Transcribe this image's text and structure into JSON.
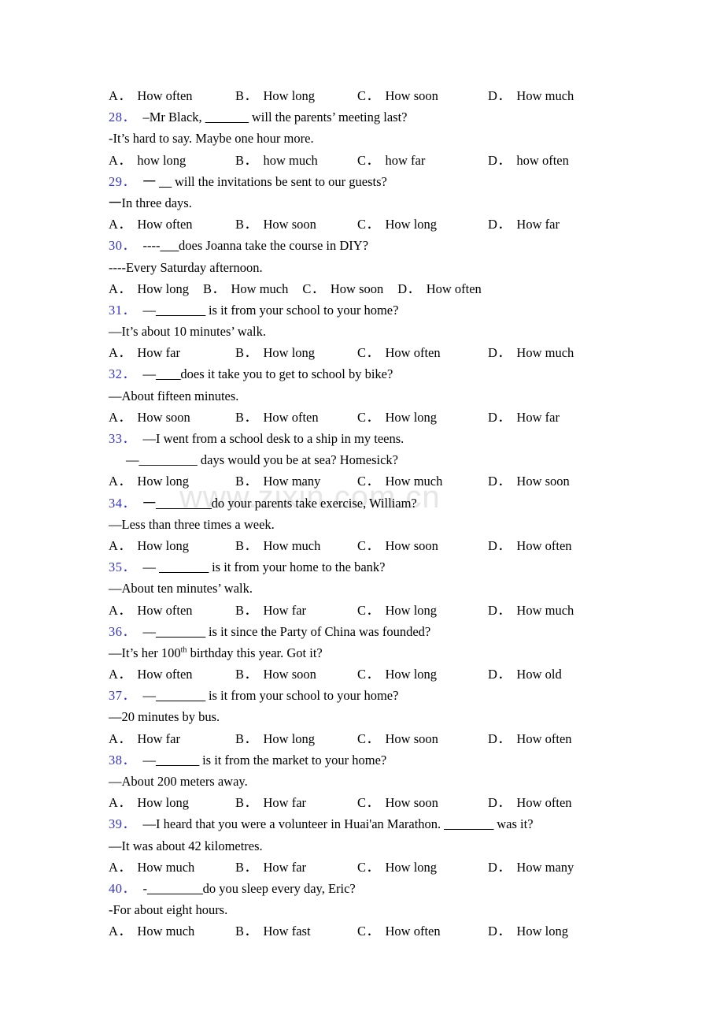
{
  "document": {
    "watermark": "www.zixin.com.cn",
    "accent_color": "#3333cc",
    "text_color": "#000000",
    "background_color": "#ffffff"
  },
  "blocks": [
    {
      "type": "options",
      "layout": "spread",
      "options": [
        {
          "letter": "A．",
          "text": "How often"
        },
        {
          "letter": "B．",
          "text": "How long"
        },
        {
          "letter": "C．",
          "text": "How soon"
        },
        {
          "letter": "D．",
          "text": "How much"
        }
      ]
    },
    {
      "type": "question",
      "number": "28．",
      "stem_before": "–Mr Black, ",
      "blank": "_______",
      "stem_after": " will the parents’ meeting last?",
      "reply": "-It’s hard to say. Maybe one hour more.",
      "layout": "spread",
      "options": [
        {
          "letter": "A．",
          "text": "how long"
        },
        {
          "letter": "B．",
          "text": "how much"
        },
        {
          "letter": "C．",
          "text": "how far"
        },
        {
          "letter": "D．",
          "text": "how often"
        }
      ]
    },
    {
      "type": "question",
      "number": "29．",
      "stem_before": "一 ",
      "blank": "__",
      "stem_after": " will the invitations be sent to our guests?",
      "reply": "一In three days.",
      "layout": "spread",
      "options": [
        {
          "letter": "A．",
          "text": "How often"
        },
        {
          "letter": "B．",
          "text": "How soon"
        },
        {
          "letter": "C．",
          "text": "How long"
        },
        {
          "letter": "D．",
          "text": "How far"
        }
      ]
    },
    {
      "type": "question",
      "number": "30．",
      "stem_before": "----",
      "blank": "___",
      "stem_after": "does Joanna take the course in DIY?",
      "reply": "----Every Saturday afternoon.",
      "layout": "compact",
      "options": [
        {
          "letter": "A．",
          "text": "How long"
        },
        {
          "letter": "B．",
          "text": "How much"
        },
        {
          "letter": "C．",
          "text": "How soon"
        },
        {
          "letter": "D．",
          "text": "How often"
        }
      ]
    },
    {
      "type": "question",
      "number": "31．",
      "stem_before": "—",
      "blank": "________",
      "stem_after": " is it from your school to your home?",
      "reply": "—It’s about 10 minutes’ walk.",
      "layout": "spread",
      "options": [
        {
          "letter": "A．",
          "text": "How far"
        },
        {
          "letter": "B．",
          "text": "How long"
        },
        {
          "letter": "C．",
          "text": "How often"
        },
        {
          "letter": "D．",
          "text": "How much"
        }
      ]
    },
    {
      "type": "question",
      "number": "32．",
      "stem_before": "—",
      "blank": "____",
      "stem_after": "does it take you to get to school by bike?",
      "reply": "—About fifteen minutes.",
      "layout": "spread",
      "options": [
        {
          "letter": "A．",
          "text": "How soon"
        },
        {
          "letter": "B．",
          "text": "How often"
        },
        {
          "letter": "C．",
          "text": "How long"
        },
        {
          "letter": "D．",
          "text": "How far"
        }
      ]
    },
    {
      "type": "question",
      "number": "33．",
      "stem_before": "—I went from a school desk to a ship in my teens.",
      "blank": "",
      "stem_after": "",
      "reply_indented": "—_________ days would you be at sea? Homesick?",
      "layout": "spread",
      "options": [
        {
          "letter": "A．",
          "text": "How long"
        },
        {
          "letter": "B．",
          "text": "How many"
        },
        {
          "letter": "C．",
          "text": "How much"
        },
        {
          "letter": "D．",
          "text": "How soon"
        }
      ]
    },
    {
      "type": "question",
      "number": "34．",
      "stem_before": "一",
      "blank": "_________",
      "stem_after": "do your parents take exercise, William?",
      "reply": "—Less than three times a week.",
      "layout": "spread",
      "options": [
        {
          "letter": "A．",
          "text": "How long"
        },
        {
          "letter": "B．",
          "text": "How much"
        },
        {
          "letter": "C．",
          "text": "How soon"
        },
        {
          "letter": "D．",
          "text": "How often"
        }
      ]
    },
    {
      "type": "question",
      "number": "35．",
      "stem_before": "— ",
      "blank": "________",
      "stem_after": " is it from your home to the bank?",
      "reply": "—About ten minutes’ walk.",
      "layout": "spread",
      "options": [
        {
          "letter": "A．",
          "text": "How often"
        },
        {
          "letter": "B．",
          "text": "How far"
        },
        {
          "letter": "C．",
          "text": "How long"
        },
        {
          "letter": "D．",
          "text": "How much"
        }
      ]
    },
    {
      "type": "question",
      "number": "36．",
      "stem_before": "—",
      "blank": "________",
      "stem_after": " is it since the Party of China was founded?",
      "reply_html": "—It’s her 100<sup>th</sup> birthday this year. Got it?",
      "layout": "spread",
      "options": [
        {
          "letter": "A．",
          "text": "How often"
        },
        {
          "letter": "B．",
          "text": "How soon"
        },
        {
          "letter": "C．",
          "text": "How long"
        },
        {
          "letter": "D．",
          "text": "How old"
        }
      ]
    },
    {
      "type": "question",
      "number": "37．",
      "stem_before": "—",
      "blank": "________",
      "stem_after": " is it from your school to your home?",
      "reply": "—20 minutes by bus.",
      "layout": "spread",
      "options": [
        {
          "letter": "A．",
          "text": "How far"
        },
        {
          "letter": "B．",
          "text": "How long"
        },
        {
          "letter": "C．",
          "text": "How soon"
        },
        {
          "letter": "D．",
          "text": "How often"
        }
      ]
    },
    {
      "type": "question",
      "number": "38．",
      "stem_before": "—",
      "blank": "_______",
      "stem_after": " is it from the market to your home?",
      "reply": "—About 200 meters away.",
      "layout": "spread",
      "options": [
        {
          "letter": "A．",
          "text": "How long"
        },
        {
          "letter": "B．",
          "text": "How far"
        },
        {
          "letter": "C．",
          "text": "How soon"
        },
        {
          "letter": "D．",
          "text": "How often"
        }
      ]
    },
    {
      "type": "question",
      "number": "39．",
      "stem_before": "—I heard that you were a volunteer in Huai'an Marathon. ",
      "blank": "________",
      "stem_after": " was it?",
      "reply": "—It was about 42 kilometres.",
      "layout": "spread",
      "options": [
        {
          "letter": "A．",
          "text": "How much"
        },
        {
          "letter": "B．",
          "text": "How far"
        },
        {
          "letter": "C．",
          "text": "How long"
        },
        {
          "letter": "D．",
          "text": "How many"
        }
      ]
    },
    {
      "type": "question",
      "number": "40．",
      "stem_before": "-",
      "blank": "_________",
      "stem_after": "do you sleep every day, Eric?",
      "reply": "-For about eight hours.",
      "layout": "spread",
      "options": [
        {
          "letter": "A．",
          "text": "How much"
        },
        {
          "letter": "B．",
          "text": "How fast"
        },
        {
          "letter": "C．",
          "text": "How often"
        },
        {
          "letter": "D．",
          "text": "How long"
        }
      ]
    }
  ]
}
